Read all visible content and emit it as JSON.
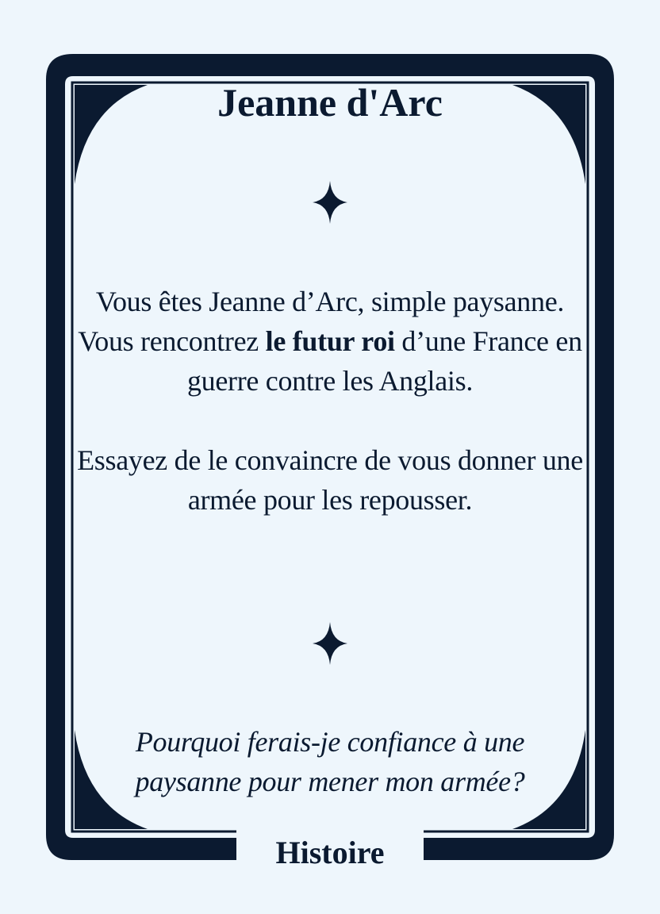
{
  "card": {
    "title": "Jeanne d'Arc",
    "intro_before": "Vous êtes Jeanne d’Arc, simple paysanne. Vous rencontrez ",
    "intro_bold": "le futur roi",
    "intro_after": " d’une France en guerre contre les Anglais.",
    "goal": "Essayez de le convaincre de vous donner une armée pour les repousser.",
    "quote": "Pourquoi ferais-je confiance à une paysanne pour mener mon armée?",
    "category": "Histoire"
  },
  "icons": {
    "top_ornament": "four-point-star-icon",
    "bottom_ornament": "four-point-star-icon"
  },
  "colors": {
    "background": "#eef6fc",
    "ink": "#0b1a30"
  }
}
